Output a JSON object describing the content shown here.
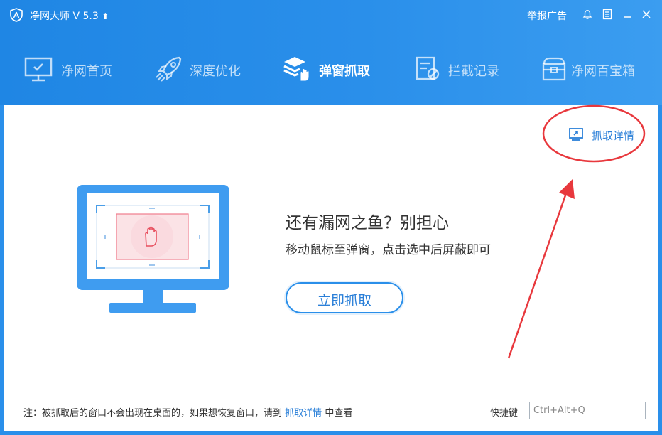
{
  "window": {
    "title": "净网大师 V 5.3",
    "report_label": "举报广告"
  },
  "nav": {
    "items": [
      {
        "label": "净网首页",
        "icon": "monitor-check-icon",
        "active": false
      },
      {
        "label": "深度优化",
        "icon": "rocket-icon",
        "active": false
      },
      {
        "label": "弹窗抓取",
        "icon": "layers-hand-icon",
        "active": true
      },
      {
        "label": "拦截记录",
        "icon": "blocked-list-icon",
        "active": false
      },
      {
        "label": "净网百宝箱",
        "icon": "toolbox-icon",
        "active": false
      }
    ]
  },
  "main": {
    "detail_link": "抓取详情",
    "headline": "还有漏网之鱼？别担心",
    "subline": "移动鼠标至弹窗，点击选中后屏蔽即可",
    "capture_button": "立即抓取"
  },
  "footer": {
    "note_prefix": "注：被抓取后的窗口不会出现在桌面的，如果想恢复窗口，请到",
    "note_link": "抓取详情",
    "note_suffix": "中查看",
    "hotkey_label": "快捷键",
    "hotkey_value": "Ctrl+Alt+Q"
  },
  "colors": {
    "accent": "#2a8fea",
    "annotation_red": "#e8383d"
  }
}
